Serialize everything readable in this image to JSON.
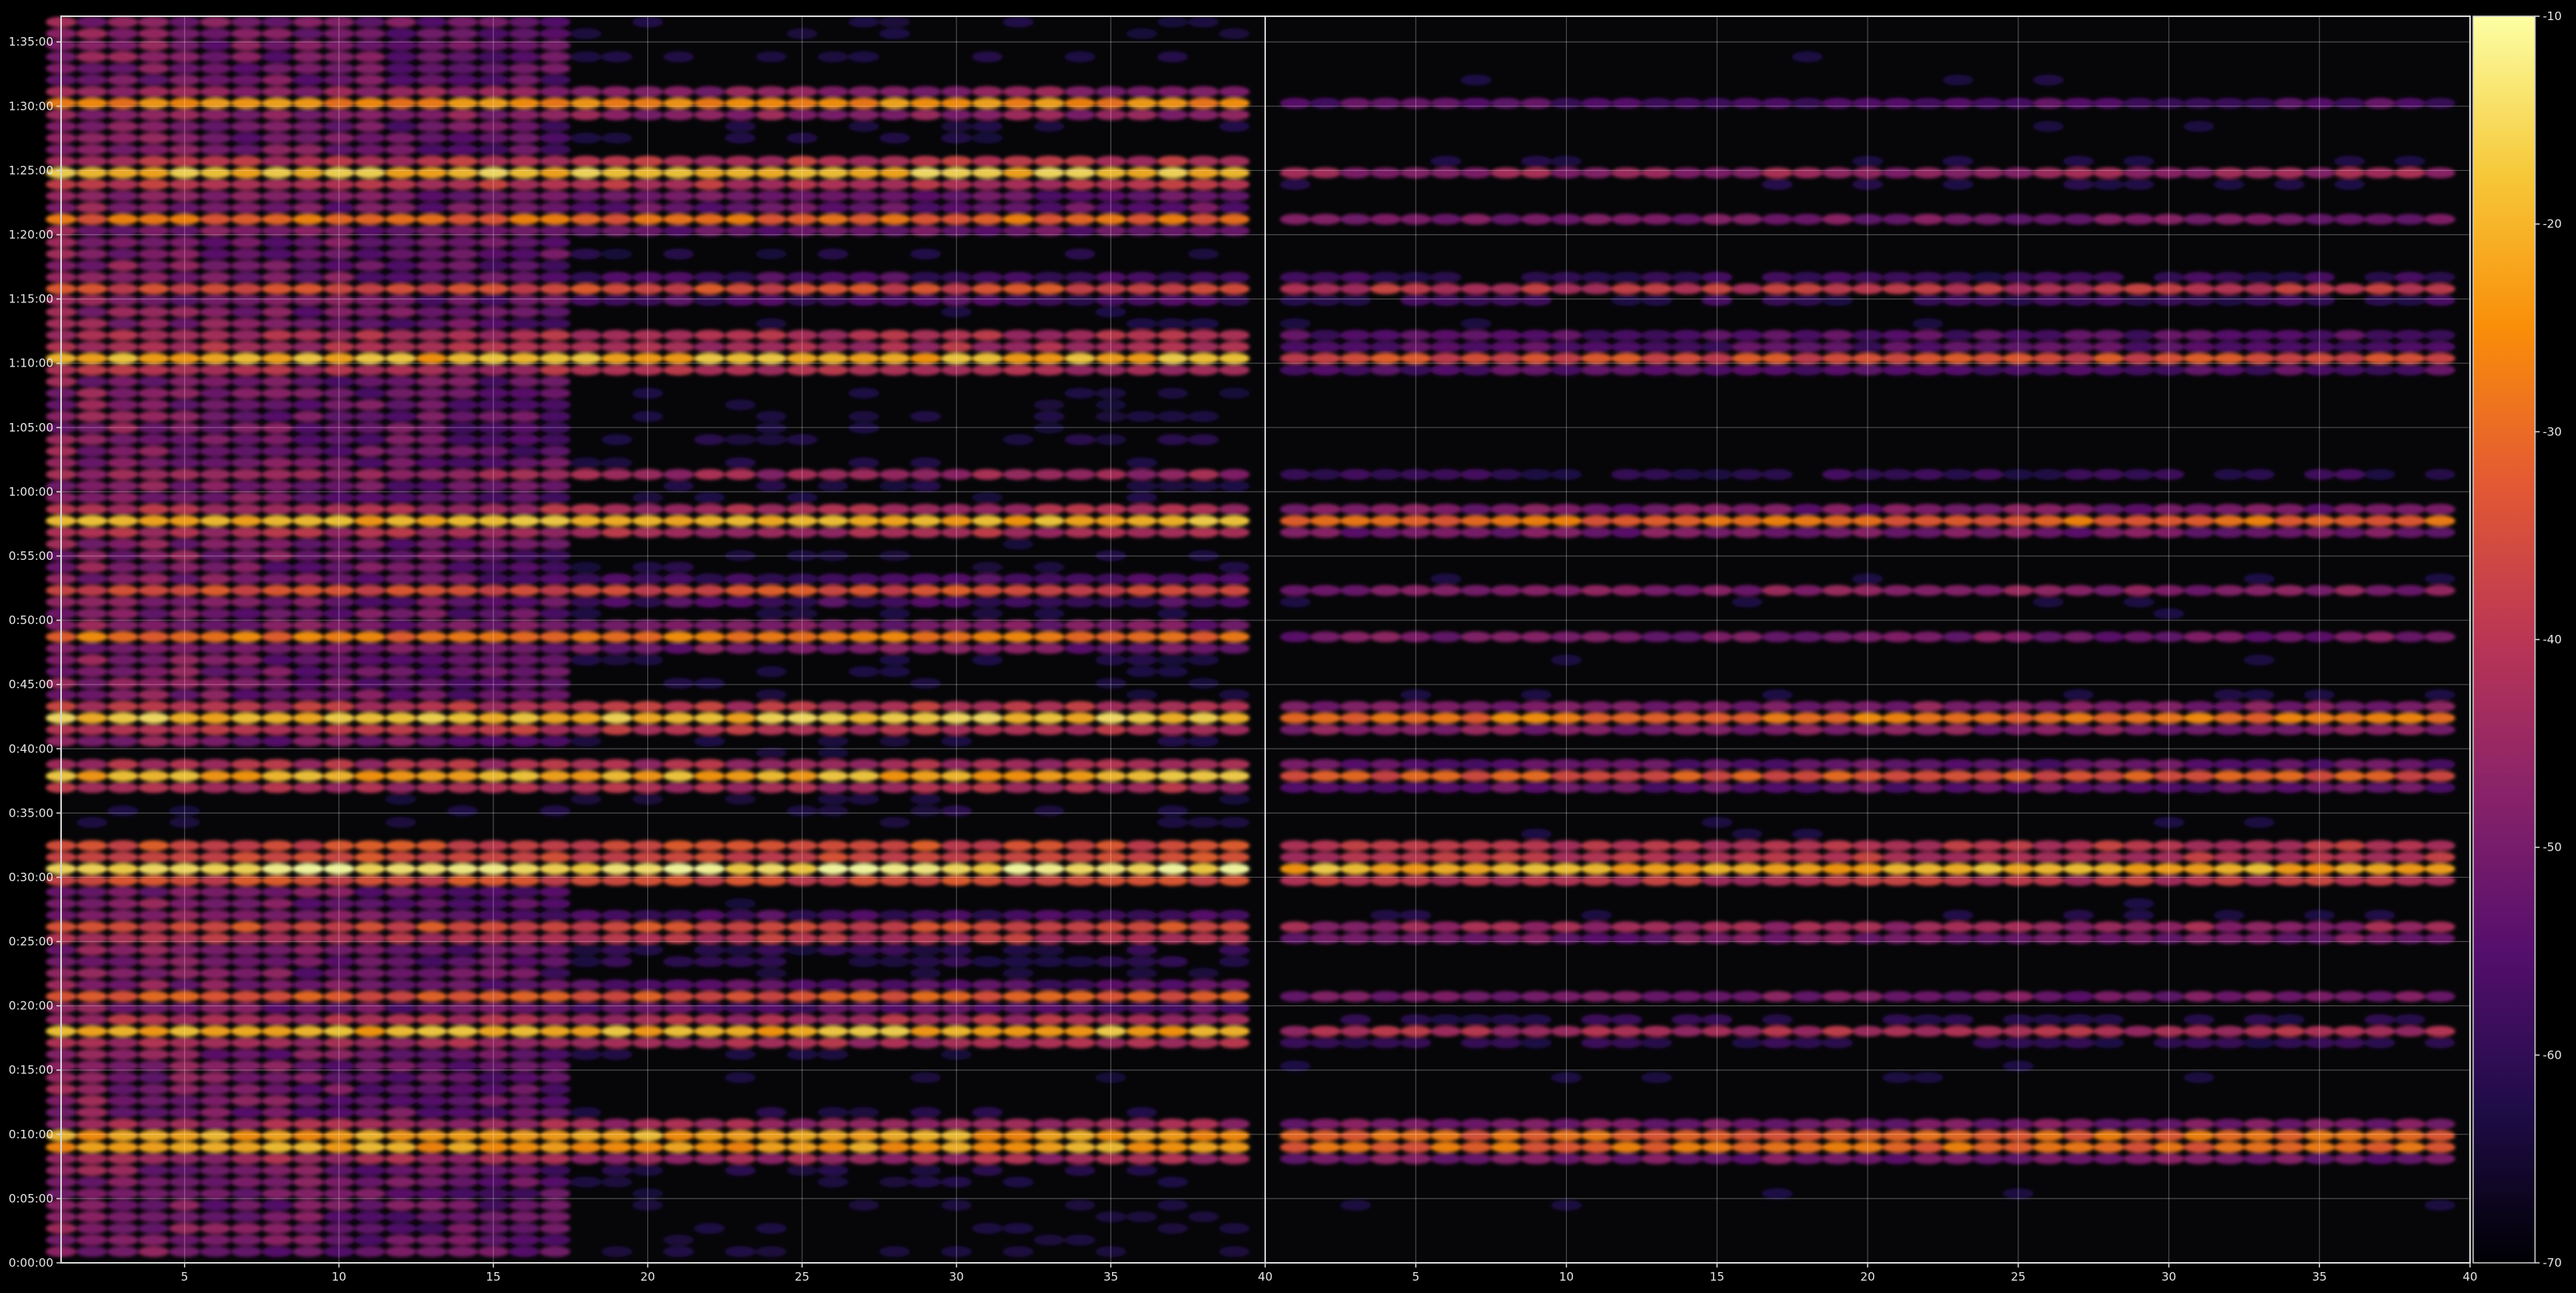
{
  "chart_data": {
    "type": "heatmap",
    "title": "",
    "xlabel": "",
    "ylabel": "",
    "panels": [
      {
        "name": "",
        "xlim": [
          1,
          40
        ]
      },
      {
        "name": "",
        "xlim": [
          1,
          40
        ]
      }
    ],
    "x_ticks": [
      5,
      10,
      15,
      20,
      25,
      30,
      35,
      40
    ],
    "y_ticks": [
      "0:00:00",
      "0:05:00",
      "0:10:00",
      "0:15:00",
      "0:20:00",
      "0:25:00",
      "0:30:00",
      "0:35:00",
      "0:40:00",
      "0:45:00",
      "0:50:00",
      "0:55:00",
      "1:00:00",
      "1:05:00",
      "1:10:00",
      "1:15:00",
      "1:20:00",
      "1:25:00",
      "1:30:00",
      "1:35:00"
    ],
    "ylim_seconds": [
      0,
      5820
    ],
    "grid": true,
    "colormap": "inferno",
    "colorbar": {
      "vmin": -70,
      "vmax": -10,
      "ticks": [
        -10,
        -20,
        -30,
        -40,
        -50,
        -60,
        -70
      ]
    },
    "bands": [
      {
        "time": "0:31:00",
        "panel1_level": -13,
        "panel2_level": -20
      },
      {
        "time": "0:42:30",
        "panel1_level": -18,
        "panel2_level": -28
      },
      {
        "time": "0:38:00",
        "panel1_level": -20,
        "panel2_level": -33
      },
      {
        "time": "0:57:40",
        "panel1_level": -20,
        "panel2_level": -30
      },
      {
        "time": "0:09:30",
        "panel1_level": -22,
        "panel2_level": -30
      },
      {
        "time": "1:25:00",
        "panel1_level": -18,
        "panel2_level": -45
      },
      {
        "time": "1:10:40",
        "panel1_level": -20,
        "panel2_level": -35
      },
      {
        "time": "0:18:00",
        "panel1_level": -20,
        "panel2_level": -42
      },
      {
        "time": "1:15:50",
        "panel1_level": -35,
        "panel2_level": -40
      },
      {
        "time": "1:30:00",
        "panel1_level": -25,
        "panel2_level": -55
      },
      {
        "time": "1:21:30",
        "panel1_level": -30,
        "panel2_level": -50
      },
      {
        "time": "0:48:30",
        "panel1_level": -28,
        "panel2_level": -50
      },
      {
        "time": "0:52:30",
        "panel1_level": -35,
        "panel2_level": -48
      },
      {
        "time": "0:26:20",
        "panel1_level": -35,
        "panel2_level": -45
      },
      {
        "time": "0:25:00",
        "panel1_level": -40,
        "panel2_level": -50
      },
      {
        "time": "0:20:40",
        "panel1_level": -33,
        "panel2_level": -50
      },
      {
        "time": "1:01:00",
        "panel1_level": -45,
        "panel2_level": -60
      }
    ]
  }
}
